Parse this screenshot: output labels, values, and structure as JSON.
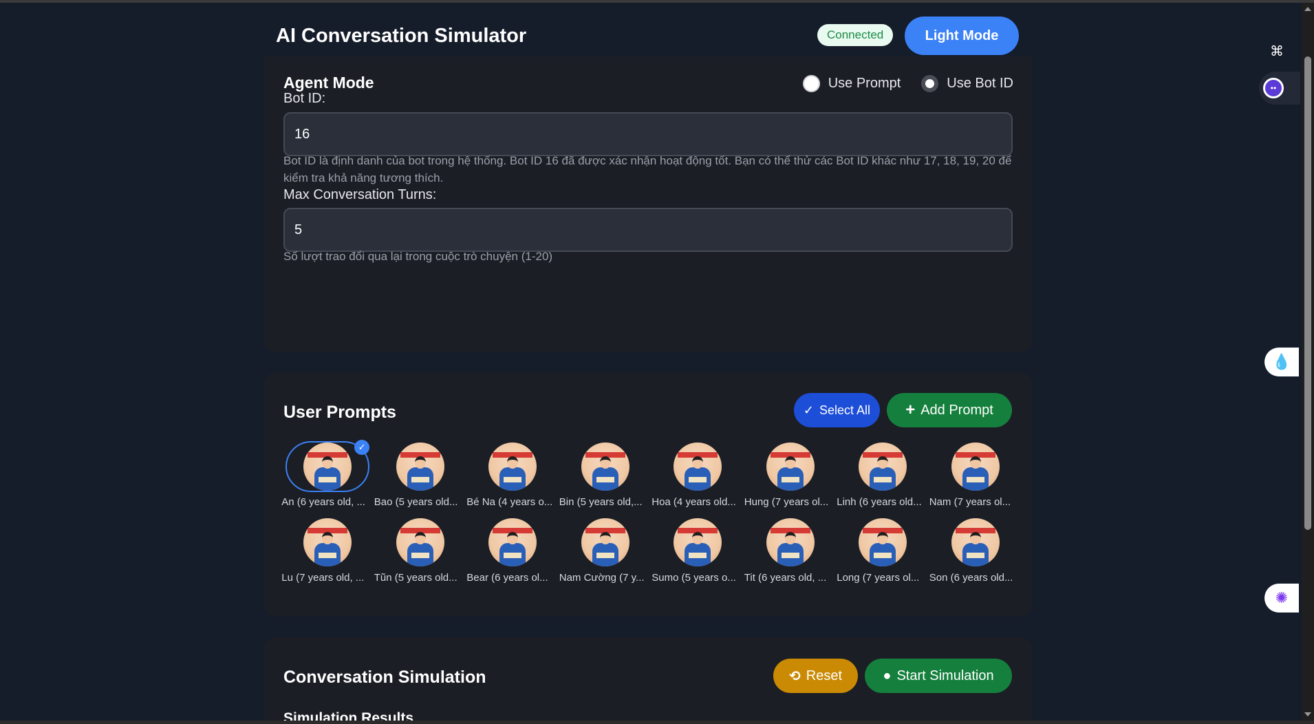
{
  "header": {
    "title": "AI Conversation Simulator",
    "status": "Connected",
    "mode_button": "Light Mode"
  },
  "agent": {
    "title": "Agent Mode",
    "options": [
      "Use Prompt",
      "Use Bot ID"
    ],
    "selected_option": "Use Bot ID",
    "bot_id_label": "Bot ID:",
    "bot_id_value": "16",
    "bot_id_help": "Bot ID là định danh của bot trong hệ thống. Bot ID 16 đã được xác nhận hoạt động tốt. Bạn có thể thử các Bot ID khác như 17, 18, 19, 20 để kiểm tra khả năng tương thích.",
    "turns_label": "Max Conversation Turns:",
    "turns_value": "5",
    "turns_help": "Số lượt trao đổi qua lại trong cuộc trò chuyện (1-20)"
  },
  "prompts": {
    "title": "User Prompts",
    "select_all": "Select All",
    "add_prompt": "Add Prompt",
    "personas": [
      {
        "name": "An (6 years old, ...",
        "selected": true
      },
      {
        "name": "Bao (5 years old...",
        "selected": false
      },
      {
        "name": "Bé Na (4 years o...",
        "selected": false
      },
      {
        "name": "Bin (5 years old,...",
        "selected": false
      },
      {
        "name": "Hoa (4 years old...",
        "selected": false
      },
      {
        "name": "Hung (7 years ol...",
        "selected": false
      },
      {
        "name": "Linh (6 years old...",
        "selected": false
      },
      {
        "name": "Nam (7 years ol...",
        "selected": false
      },
      {
        "name": "Lu (7 years old, ...",
        "selected": false
      },
      {
        "name": "Tũn (5 years old...",
        "selected": false
      },
      {
        "name": "Bear (6 years ol...",
        "selected": false
      },
      {
        "name": "Nam Cường (7 y...",
        "selected": false
      },
      {
        "name": "Sumo (5 years o...",
        "selected": false
      },
      {
        "name": "Tit (6 years old, ...",
        "selected": false
      },
      {
        "name": "Long (7 years ol...",
        "selected": false
      },
      {
        "name": "Son (6 years old...",
        "selected": false
      }
    ]
  },
  "simulation": {
    "title": "Conversation Simulation",
    "reset": "Reset",
    "start": "Start Simulation",
    "results_heading": "Simulation Results"
  },
  "colors": {
    "primary": "#3b82f6",
    "success": "#15803d",
    "warning": "#ca8a04",
    "badge_bg": "#e9faf0"
  }
}
